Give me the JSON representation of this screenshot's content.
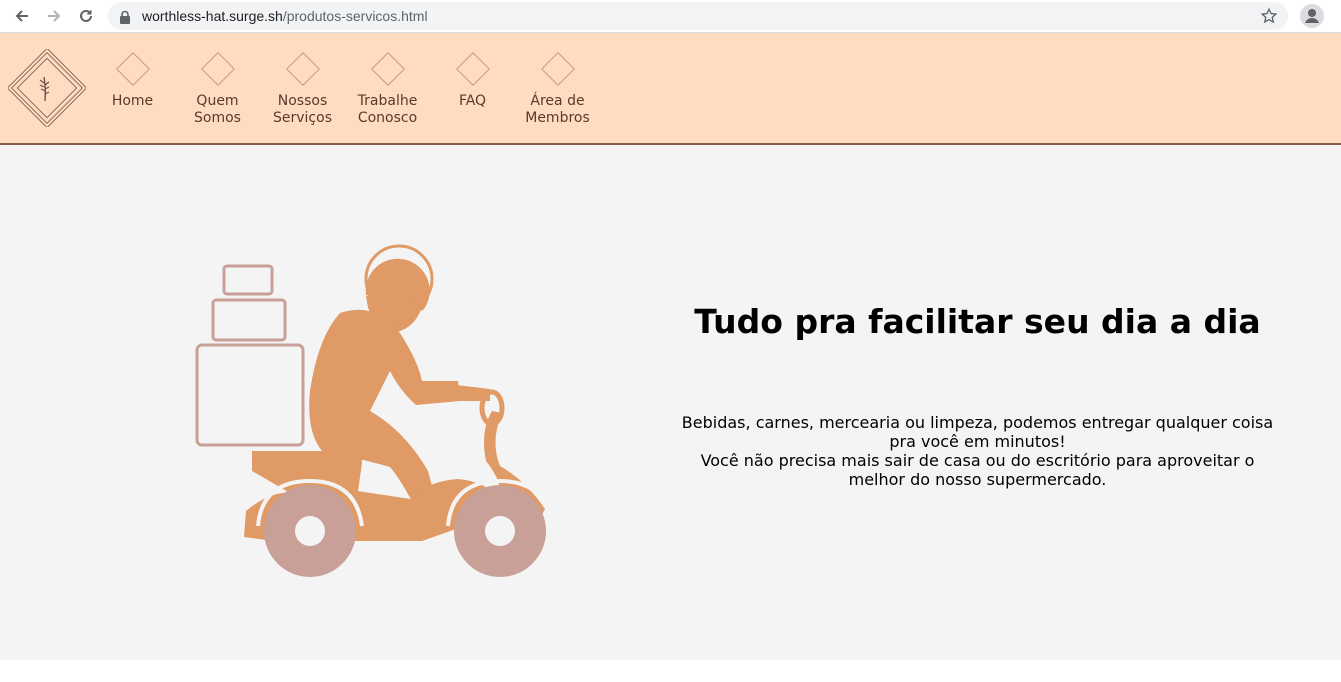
{
  "browser": {
    "url_domain": "worthless-hat.surge.sh",
    "url_path": "/produtos-servicos.html"
  },
  "nav": {
    "items": [
      {
        "label": "Home"
      },
      {
        "label": "Quem\nSomos"
      },
      {
        "label": "Nossos\nServiços"
      },
      {
        "label": "Trabalhe\nConosco"
      },
      {
        "label": "FAQ"
      },
      {
        "label": "Área de\nMembros"
      }
    ]
  },
  "hero": {
    "title": "Tudo pra facilitar seu dia a dia",
    "line1": "Bebidas, carnes, mercearia ou limpeza, podemos entregar qualquer coisa pra você em minutos!",
    "line2": "Você não precisa mais sair de casa ou do escritório para aproveitar o melhor do nosso supermercado."
  },
  "colors": {
    "header_bg": "#ffdcc1",
    "main_bg": "#f4f4f4",
    "rider": "#e09a66",
    "wheel": "#c9a097"
  }
}
